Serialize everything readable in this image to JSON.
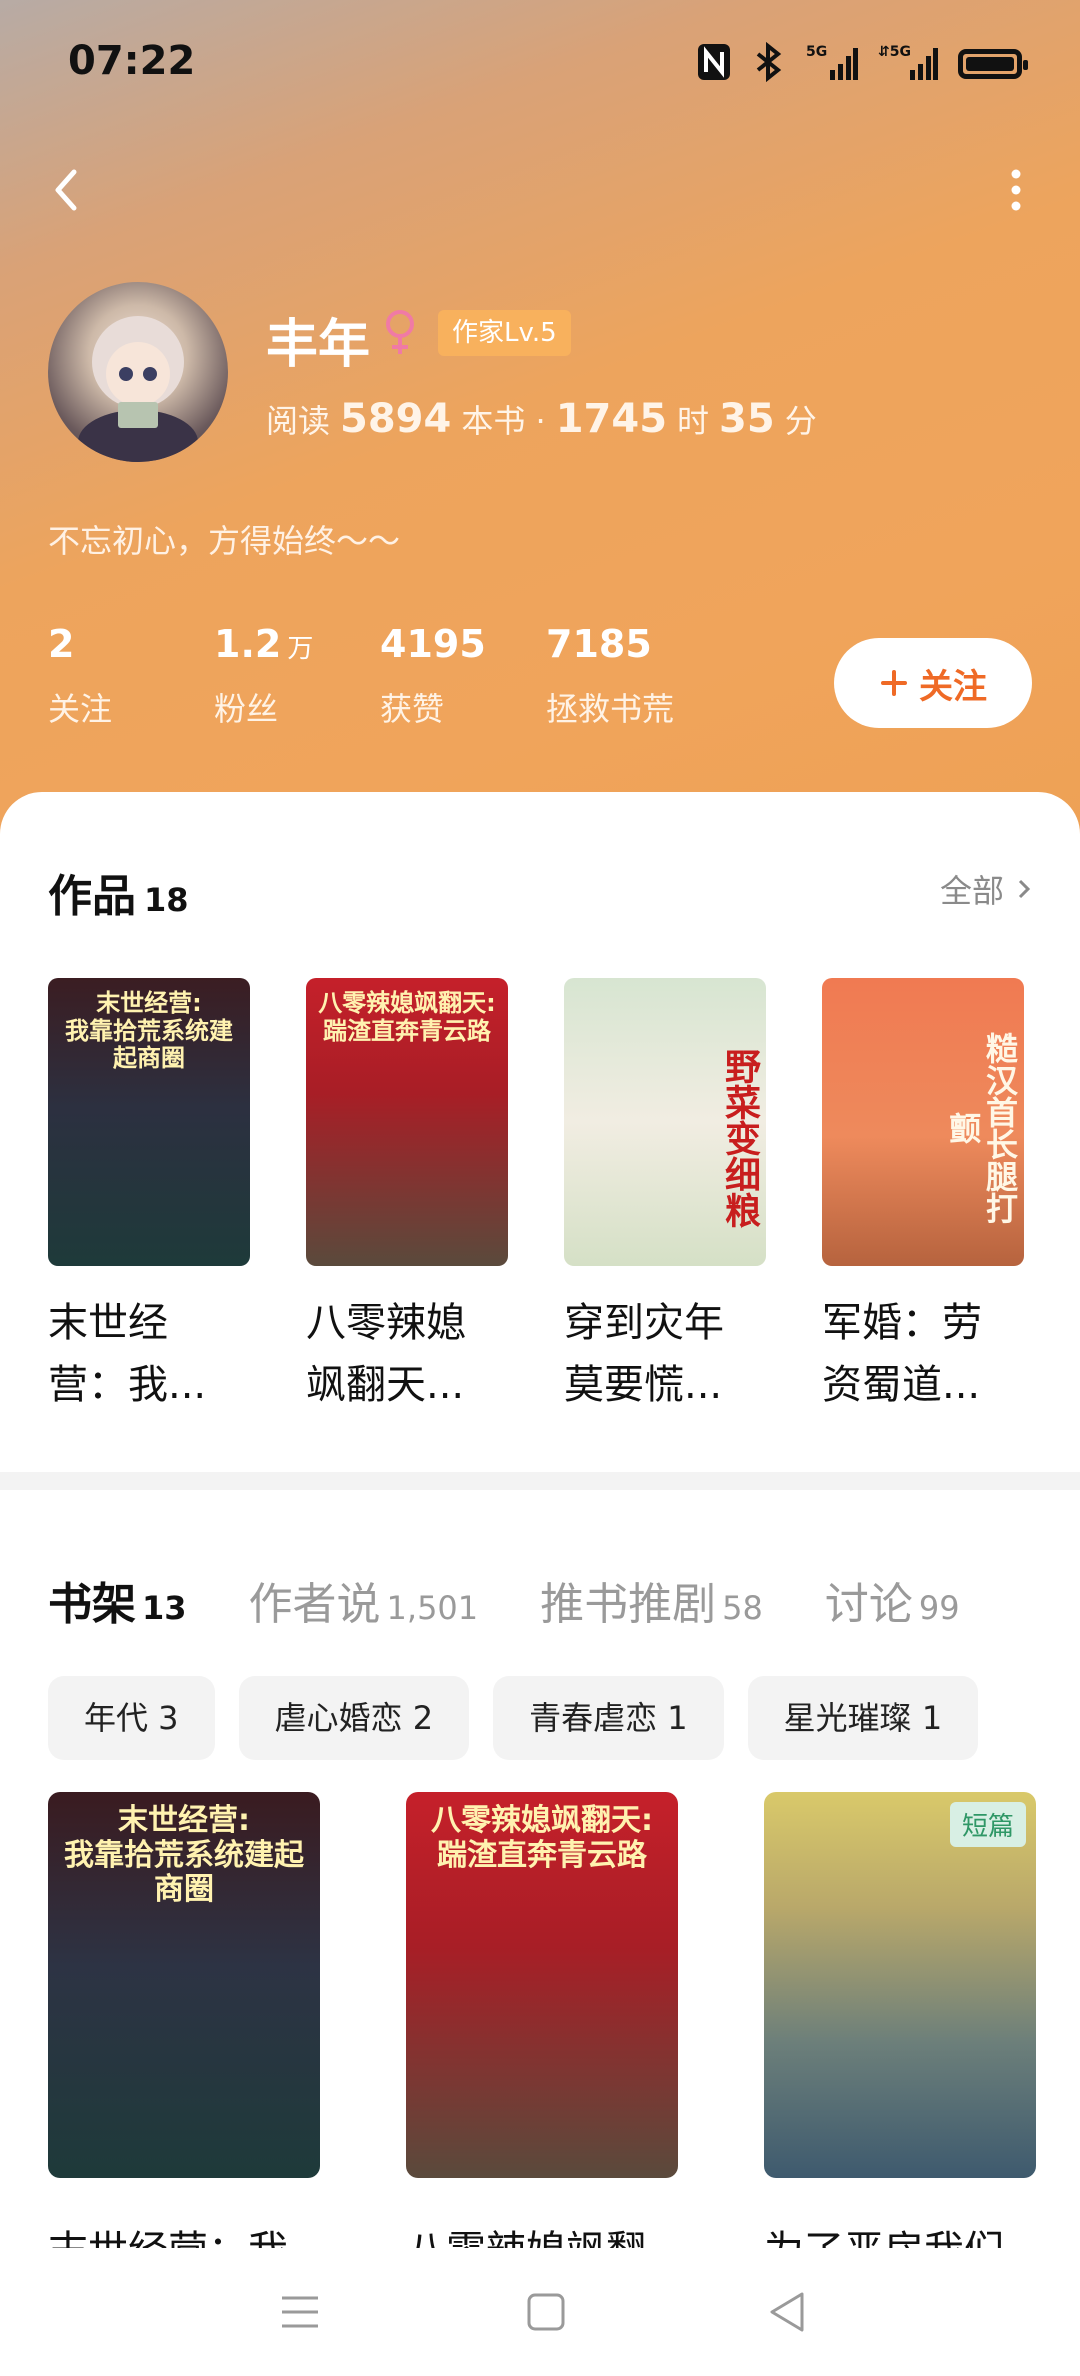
{
  "status_bar": {
    "time": "07:22",
    "icons": [
      "nfc-icon",
      "bluetooth-icon",
      "5g-signal-icon",
      "5g-signal-icon",
      "battery-icon"
    ],
    "signal_labels": [
      "5G",
      "5G"
    ]
  },
  "header": {
    "back_icon": "chevron-left-icon",
    "more_icon": "vertical-dots-icon"
  },
  "profile": {
    "name": "丰年",
    "gender_icon": "female-icon",
    "level_badge": "作家Lv.5",
    "reading_label": "阅读",
    "reading_books": "5894",
    "reading_books_unit": "本书 ·",
    "reading_hours": "1745",
    "reading_hours_unit": "时",
    "reading_minutes": "35",
    "reading_minutes_unit": "分",
    "motto": "不忘初心，方得始终～～"
  },
  "stats": [
    {
      "value": "2",
      "unit": "",
      "label": "关注"
    },
    {
      "value": "1.2",
      "unit": "万",
      "label": "粉丝"
    },
    {
      "value": "4195",
      "unit": "",
      "label": "获赞"
    },
    {
      "value": "7185",
      "unit": "",
      "label": "拯救书荒"
    }
  ],
  "follow_button": {
    "icon": "plus-icon",
    "label": "关注"
  },
  "works": {
    "title": "作品",
    "count": "18",
    "see_all": "全部",
    "books": [
      {
        "title_line1": "末世经",
        "title_line2": "营：我...",
        "cover_text": "末世经营:\n我靠拾荒系统建起商圈"
      },
      {
        "title_line1": "八零辣媳",
        "title_line2": "飒翻天...",
        "cover_text": "八零辣媳飒翻天:\n踹渣直奔青云路"
      },
      {
        "title_line1": "穿到灾年",
        "title_line2": "莫要慌...",
        "cover_text": "野菜变细粮"
      },
      {
        "title_line1": "军婚：劳",
        "title_line2": "资蜀道...",
        "cover_text": "糙汉首长腿打颤"
      }
    ]
  },
  "tabs": [
    {
      "label": "书架",
      "count": "13",
      "active": true
    },
    {
      "label": "作者说",
      "count": "1,501",
      "active": false
    },
    {
      "label": "推书推剧",
      "count": "58",
      "active": false
    },
    {
      "label": "讨论",
      "count": "99",
      "active": false
    }
  ],
  "chips": [
    "年代 3",
    "虐心婚恋 2",
    "青春虐恋 1",
    "星光璀璨 1"
  ],
  "shelf": [
    {
      "title": "末世经营：我",
      "cover_text": "末世经营:\n我靠拾荒系统建起商圈",
      "tag": ""
    },
    {
      "title": "八零辣媳飒翻",
      "cover_text": "八零辣媳飒翻天:\n踹渣直奔青云路",
      "tag": ""
    },
    {
      "title": "为了恶房我们",
      "cover_text": "",
      "tag": "短篇"
    }
  ],
  "bottom_nav": [
    "menu-icon",
    "home-square-icon",
    "back-triangle-icon"
  ]
}
